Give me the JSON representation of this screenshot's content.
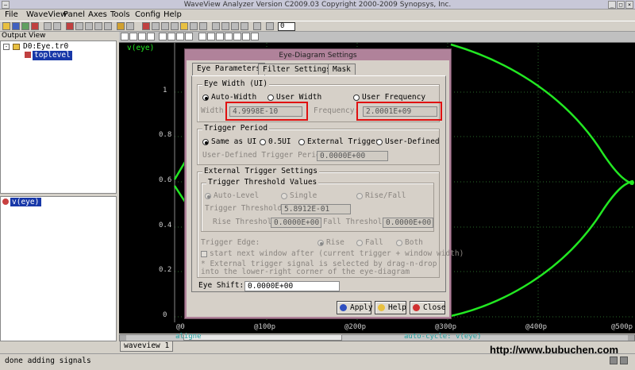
{
  "app": {
    "title": "WaveView Analyzer Version C2009.03 Copyright 2000-2009 Synopsys, Inc.",
    "menu": [
      "File",
      "WaveView",
      "Panel",
      "Axes",
      "Tools",
      "Config",
      "Help"
    ],
    "zoom_value": "0"
  },
  "left": {
    "output_view_label": "Output View",
    "tree": {
      "root": "D0:Eye.tr0",
      "child": "toplevel"
    },
    "signal": "v(eye)"
  },
  "wave": {
    "signal_label": "v(eye)",
    "y_ticks": [
      "1",
      "0.8",
      "0.6",
      "0.4",
      "0.2",
      "0"
    ],
    "x_ticks": [
      "0",
      "@100p",
      "@200p",
      "@300p",
      "@400p",
      "@500p"
    ],
    "x_first": "@0",
    "align_label": "aligne",
    "autocycle_label": "auto-cycle: v(eye)",
    "tab_label": "waveview 1"
  },
  "status": {
    "text": "done adding signals",
    "watermark": "http://www.bubuchen.com"
  },
  "dialog": {
    "title": "Eye-Diagram Settings",
    "tabs": [
      "Eye Parameters",
      "Filter Settings",
      "Mask"
    ],
    "eye_width": {
      "label": "Eye Width (UI)",
      "auto": "Auto-Width",
      "user": "User Width",
      "freq": "User Frequency",
      "width_label": "Width:",
      "width_value": "4.9998E-10",
      "freq_label": "Frequency:",
      "freq_value": "2.0001E+09"
    },
    "trigger_period": {
      "label": "Trigger Period",
      "same": "Same as UI",
      "half": "0.5UI",
      "external": "External Trigger",
      "user": "User-Defined",
      "user_label": "User-Defined Trigger Period:",
      "user_value": "0.0000E+00"
    },
    "external": {
      "label": "External Trigger Settings",
      "threshold_group": "Trigger Threshold Values",
      "auto": "Auto-Level",
      "single": "Single",
      "risefall": "Rise/Fall",
      "trig_thresh_label": "Trigger Threshold:",
      "trig_thresh_value": "5.8912E-01",
      "rise_label": "Rise Threshold:",
      "rise_value": "0.0000E+00",
      "fall_label": "Fall Threshold:",
      "fall_value": "0.0000E+00",
      "edge_label": "Trigger Edge:",
      "edge_rise": "Rise",
      "edge_fall": "Fall",
      "edge_both": "Both",
      "next_window": "start next window after (current trigger + window width)",
      "note1": "* External trigger signal is selected by drag-n-drop",
      "note2": "into the lower-right corner of the eye-diagram"
    },
    "eye_shift_label": "Eye Shift:",
    "eye_shift_value": "0.0000E+00",
    "buttons": {
      "apply": "Apply",
      "help": "Help",
      "close": "Close"
    }
  },
  "colors": {
    "wave": "#22e822",
    "highlight": "#e01010",
    "dialog_frame": "#b0829a"
  }
}
